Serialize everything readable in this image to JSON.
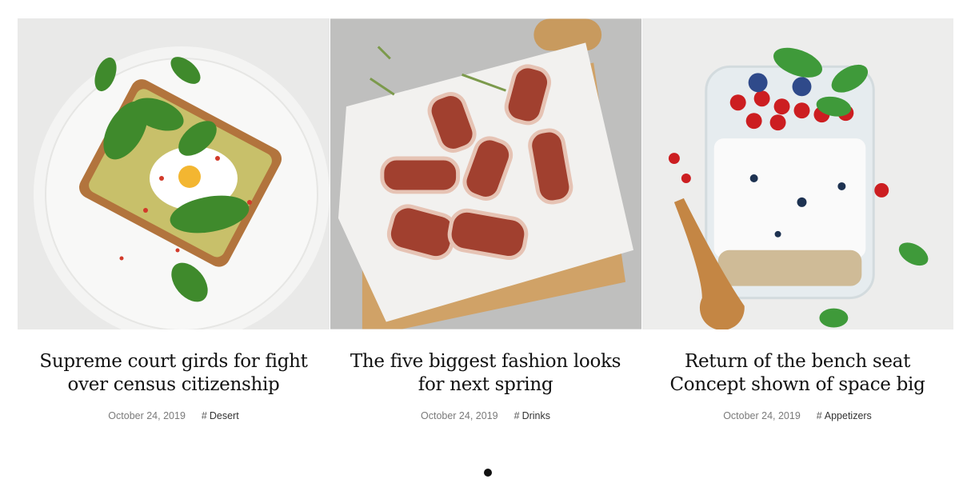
{
  "posts": [
    {
      "title": "Supreme court girds for fight over census citizenship",
      "date": "October 24, 2019",
      "category": "Desert",
      "image": "avocado-toast-egg-spinach-plate"
    },
    {
      "title": "The five biggest fashion looks for next spring",
      "date": "October 24, 2019",
      "category": "Drinks",
      "image": "bacon-wrapped-skewers-cutting-board"
    },
    {
      "title": "Return of the bench seat Concept shown of space big",
      "date": "October 24, 2019",
      "category": "Appetizers",
      "image": "yogurt-parfait-berries-jar"
    }
  ],
  "category_marker": "#",
  "pagination": {
    "active_index": 0,
    "count": 1
  },
  "colors": {
    "title": "#111111",
    "date": "#7a7a7a",
    "category": "#333333",
    "dot_active": "#111111"
  }
}
